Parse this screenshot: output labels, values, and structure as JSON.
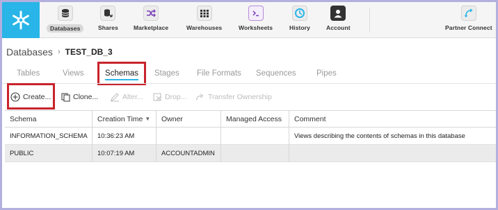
{
  "nav": {
    "items": [
      {
        "label": "Databases",
        "icon": "database-icon",
        "active": true
      },
      {
        "label": "Shares",
        "icon": "shares-icon"
      },
      {
        "label": "Marketplace",
        "icon": "marketplace-icon"
      },
      {
        "label": "Warehouses",
        "icon": "warehouse-icon"
      },
      {
        "label": "Worksheets",
        "icon": "terminal-icon"
      },
      {
        "label": "History",
        "icon": "history-icon"
      },
      {
        "label": "Account",
        "icon": "account-icon"
      }
    ],
    "partner": {
      "label": "Partner Connect",
      "icon": "partner-connect-icon"
    }
  },
  "colors": {
    "brand": "#29b5e8",
    "highlight": "#c8232c"
  },
  "breadcrumb": {
    "root": "Databases",
    "separator": "›",
    "current": "TEST_DB_3"
  },
  "tabs": [
    "Tables",
    "Views",
    "Schemas",
    "Stages",
    "File Formats",
    "Sequences",
    "Pipes"
  ],
  "active_tab": "Schemas",
  "toolbar": {
    "create": "Create...",
    "clone": "Clone...",
    "alter": "Alter...",
    "drop": "Drop...",
    "transfer": "Transfer Ownership"
  },
  "table": {
    "headers": [
      "Schema",
      "Creation Time",
      "Owner",
      "Managed Access",
      "Comment"
    ],
    "sort_indicator": "▼",
    "rows": [
      [
        "INFORMATION_SCHEMA",
        "10:36:23 AM",
        "",
        "",
        "Views describing the contents of schemas in this database"
      ],
      [
        "PUBLIC",
        "10:07:19 AM",
        "ACCOUNTADMIN",
        "",
        ""
      ]
    ]
  }
}
